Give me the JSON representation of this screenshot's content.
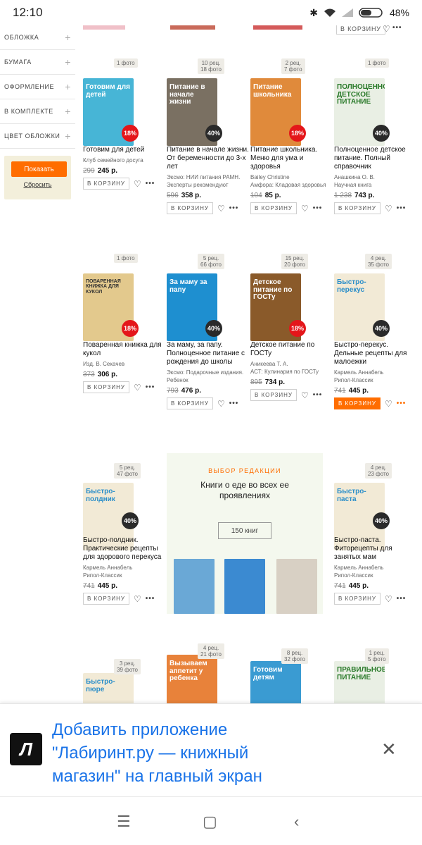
{
  "status": {
    "time": "12:10",
    "battery": "48%"
  },
  "sidebar": {
    "filters": [
      {
        "label": "ОБЛОЖКА"
      },
      {
        "label": "БУМАГА"
      },
      {
        "label": "ОФОРМЛЕНИЕ"
      },
      {
        "label": "В КОМПЛЕКТЕ"
      },
      {
        "label": "ЦВЕТ ОБЛОЖКИ"
      }
    ],
    "show_button": "Показать",
    "reset_link": "Сбросить"
  },
  "top_cart_label": "В КОРЗИНУ",
  "products": [
    {
      "photo": "1 фото",
      "discount": "18%",
      "title": "Готовим для детей",
      "meta": "Клуб семейного досуга",
      "old_price": "299",
      "price": "245 р.",
      "cart": "В КОРЗИНУ",
      "cover_text": "Готовим для детей",
      "cover_color": "#47b5d6"
    },
    {
      "photo": "10 рец.\n18 фото",
      "discount": "40%",
      "title": "Питание в начале жизни. От беременности до 3-х лет",
      "meta": "Эксмо: НИИ питания РАМН. Эксперты рекомендуют",
      "old_price": "596",
      "price": "358 р.",
      "cart": "В КОРЗИНУ",
      "cover_text": "Питание в начале жизни",
      "cover_color": "#7a7062"
    },
    {
      "photo": "2 рец.\n7 фото",
      "discount": "18%",
      "title": "Питание школьника. Меню для ума и здоровья",
      "meta": "Bailey Christine\nАмфора: Кладовая здоровья",
      "old_price": "104",
      "price": "85 р.",
      "cart": "В КОРЗИНУ",
      "cover_text": "Питание школьника",
      "cover_color": "#e08a3b"
    },
    {
      "photo": "1 фото",
      "discount": "40%",
      "title": "Полноценное детское питание. Полный справочник",
      "meta": "Анашкина О. В.\nНаучная книга",
      "old_price": "1 238",
      "price": "743 р.",
      "cart": "В КОРЗИНУ",
      "cover_text": "ПОЛНОЦЕННОЕ ДЕТСКОЕ ПИТАНИЕ",
      "cover_color": "#e9efe4"
    },
    {
      "photo": "1 фото",
      "discount": "18%",
      "title": "Поваренная книжка для кукол",
      "meta": "Изд. В. Секачев",
      "old_price": "373",
      "price": "306 р.",
      "cart": "В КОРЗИНУ",
      "cover_text": "ПОВАРЕННАЯ КНИЖКА ДЛЯ КУКОЛ",
      "cover_color": "#e3c98d"
    },
    {
      "photo": "5 рец.\n66 фото",
      "discount": "40%",
      "title": "За маму, за папу. Полноценное питание с рождения до школы",
      "meta": "Эксмо: Подарочные издания. Ребенок",
      "old_price": "793",
      "price": "476 р.",
      "cart": "В КОРЗИНУ",
      "cover_text": "За маму за папу",
      "cover_color": "#1e8fd0"
    },
    {
      "photo": "15 рец.\n20 фото",
      "discount": "18%",
      "title": "Детское питание по ГОСТу",
      "meta": "Аникеева Т. А.\nАСТ: Кулинария по ГОСТу",
      "old_price": "895",
      "price": "734 р.",
      "cart": "В КОРЗИНУ",
      "cover_text": "Детское питание по ГОСТу",
      "cover_color": "#8a5a2a"
    },
    {
      "photo": "4 рец.\n35 фото",
      "discount": "40%",
      "title": "Быстро-перекус. Дельные рецепты для малоежки",
      "meta": "Кармель Аннабель\nРипол-Классик",
      "old_price": "741",
      "price": "445 р.",
      "cart": "В КОРЗИНУ",
      "cover_text": "Быстро-перекус",
      "cover_color": "#f2ead6"
    },
    {
      "photo": "5 рец.\n47 фото",
      "discount": "40%",
      "title": "Быстро-полдник. Практические рецепты для здорового перекуса",
      "meta": "Кармель Аннабель\nРипол-Классик",
      "old_price": "741",
      "price": "445 р.",
      "cart": "В КОРЗИНУ",
      "cover_text": "Быстро-полдник",
      "cover_color": "#f2ead6"
    },
    {
      "photo": "4 рец.\n23 фото",
      "discount": "40%",
      "title": "Быстро-паста. Фиторецепты для занятых мам",
      "meta": "Кармель Аннабель\nРипол-Классик",
      "old_price": "741",
      "price": "445 р.",
      "cart": "В КОРЗИНУ",
      "cover_text": "Быстро-паста",
      "cover_color": "#f2ead6"
    },
    {
      "photo": "3 рец.\n39 фото",
      "cover_text": "Быстро-пюре",
      "cover_color": "#f2ead6"
    },
    {
      "photo": "4 рец.\n21 фото",
      "cover_text": "Вызываем аппетит у ребенка",
      "cover_color": "#e8823a"
    },
    {
      "photo": "8 рец.\n32 фото",
      "cover_text": "Готовим детям",
      "cover_color": "#3a9bd2"
    },
    {
      "photo": "1 рец.\n5 фото",
      "cover_text": "ПРАВИЛЬНОЕ ПИТАНИЕ",
      "cover_color": "#e9efe4"
    }
  ],
  "promo": {
    "kicker": "ВЫБОР РЕДАКЦИИ",
    "headline": "Книги о еде во всех ее проявлениях",
    "count": "150 книг"
  },
  "banner": {
    "text": "Добавить приложение \"Лабиринт.ру — книжный магазин\" на главный экран",
    "close_icon": "close-icon"
  },
  "colors": {
    "accent": "#ff6d00",
    "discount_red": "#e4161a",
    "discount_dark": "#2a2a2a",
    "link_blue": "#1a73e8"
  }
}
